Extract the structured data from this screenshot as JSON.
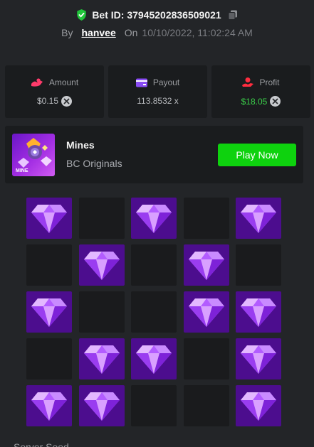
{
  "header": {
    "bet_id_label": "Bet ID: 37945202836509021",
    "by_label": "By",
    "username": "hanvee",
    "on_label": "On",
    "date": "10/10/2022, 11:02:24 AM"
  },
  "stats": [
    {
      "title": "Amount",
      "value": "$0.15",
      "icon": "amount-icon"
    },
    {
      "title": "Payout",
      "value": "113.8532 x",
      "icon": "payout-icon"
    },
    {
      "title": "Profit",
      "value": "$18.05",
      "icon": "profit-icon"
    }
  ],
  "game": {
    "name": "Mines",
    "provider": "BC Originals",
    "thumb_label": "MINE",
    "play_label": "Play Now"
  },
  "board": {
    "rows": [
      [
        1,
        0,
        1,
        0,
        1
      ],
      [
        0,
        1,
        0,
        1,
        0
      ],
      [
        1,
        0,
        0,
        1,
        1
      ],
      [
        0,
        1,
        1,
        0,
        1
      ],
      [
        1,
        1,
        0,
        0,
        1
      ]
    ]
  },
  "footer": {
    "label": "Server Seed"
  },
  "colors": {
    "background": "#232528",
    "card": "#1a1c1e",
    "accent_green": "#0ed20e",
    "gem_tile": "#4c0d8e",
    "profit_green": "#3bd04a"
  }
}
